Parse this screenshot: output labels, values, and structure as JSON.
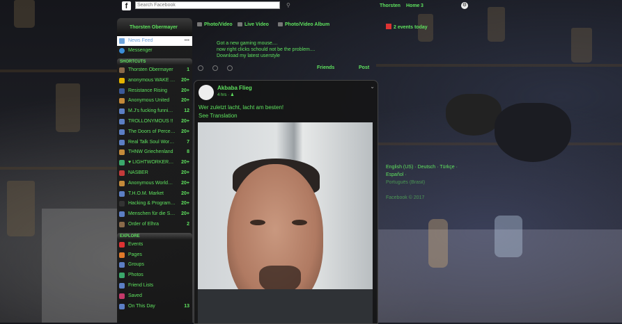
{
  "topbar": {
    "logo": "f",
    "search_placeholder": "Search Facebook",
    "user": "Thorsten",
    "home": "Home",
    "home_count": "3"
  },
  "sidebar": {
    "profile": "Thorsten Obermayer",
    "news_feed": "News Feed",
    "messenger": "Messenger",
    "shortcuts_title": "SHORTCUTS",
    "shortcuts": [
      {
        "label": "Thorsten Obermayer",
        "count": "1",
        "color": "#8a6a4a"
      },
      {
        "label": "anonymous WAKE T...",
        "count": "20+",
        "color": "#e6b400"
      },
      {
        "label": "Resistance Rising",
        "count": "20+",
        "color": "#3b5998"
      },
      {
        "label": "Anonymous United",
        "count": "20+",
        "color": "#c48a3a"
      },
      {
        "label": "M.J's fucking funniest...",
        "count": "12",
        "color": "#5c7fc4"
      },
      {
        "label": "TROLLONYMOUS !!",
        "count": "20+",
        "color": "#5c7fc4"
      },
      {
        "label": "The Doors of Percept...",
        "count": "20+",
        "color": "#5c7fc4"
      },
      {
        "label": "Real Talk Soul Worke...",
        "count": "7",
        "color": "#5c7fc4"
      },
      {
        "label": "THNW Griechenland",
        "count": "8",
        "color": "#c48a3a"
      },
      {
        "label": "♥ LIGHTWORKERS o...",
        "count": "20+",
        "color": "#3aa86b"
      },
      {
        "label": "NASBER",
        "count": "20+",
        "color": "#c43a3a"
      },
      {
        "label": "Anonymous Worldwi...",
        "count": "20+",
        "color": "#c48a3a"
      },
      {
        "label": "T.H.O.M. Market",
        "count": "20+",
        "color": "#5c7fc4"
      },
      {
        "label": "Hacking & Programm...",
        "count": "20+",
        "color": "#333333"
      },
      {
        "label": "Menschen für die So...",
        "count": "20+",
        "color": "#5c7fc4"
      },
      {
        "label": "Order of Elhra",
        "count": "2",
        "color": "#8a6a4a"
      }
    ],
    "explore_title": "EXPLORE",
    "explore": [
      {
        "label": "Events",
        "count": "",
        "color": "#d33"
      },
      {
        "label": "Pages",
        "count": "",
        "color": "#e07a2a"
      },
      {
        "label": "Groups",
        "count": "",
        "color": "#5c7fc4"
      },
      {
        "label": "Photos",
        "count": "",
        "color": "#3aa86b"
      },
      {
        "label": "Friend Lists",
        "count": "",
        "color": "#5c7fc4"
      },
      {
        "label": "Saved",
        "count": "",
        "color": "#c43a6a"
      },
      {
        "label": "On This Day",
        "count": "13",
        "color": "#5c7fc4"
      }
    ]
  },
  "composer": {
    "tab_photo_video": "Photo/Video",
    "tab_live_video": "Live Video",
    "tab_album": "Photo/Video Album",
    "text_line1": "Got a new gaming mouse....",
    "text_line2": "now right clicks schould not be the problem....",
    "text_line3": "Download my latest userstyle",
    "audience": "Friends",
    "post_button": "Post"
  },
  "post": {
    "author": "Akbaba Flieg",
    "time": "4 hrs",
    "text": "Wer zuletzt lacht, lacht am besten!",
    "see_translation": "See Translation"
  },
  "right": {
    "events": "2 events today",
    "lang_line1": "English (US) · Deutsch · Türkçe · Español ·",
    "lang_line2": "Português (Brasil)",
    "lang_line3": "",
    "lang_line4": "Facebook © 2017"
  }
}
